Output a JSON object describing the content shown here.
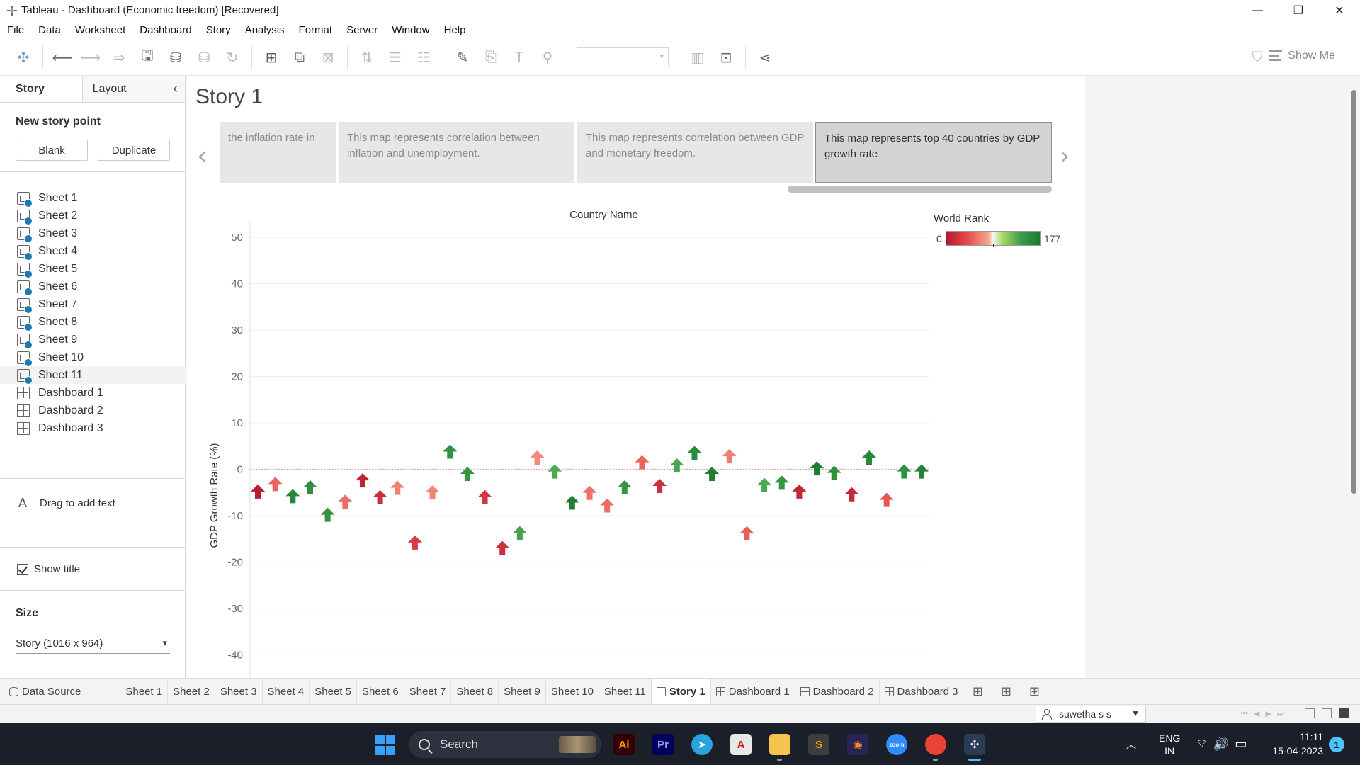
{
  "window": {
    "title": "Tableau - Dashboard (Economic freedom) [Recovered]",
    "controls": {
      "minimize": "—",
      "restore": "❐",
      "close": "✕"
    }
  },
  "menu": [
    "File",
    "Data",
    "Worksheet",
    "Dashboard",
    "Story",
    "Analysis",
    "Format",
    "Server",
    "Window",
    "Help"
  ],
  "toolbar": {
    "show_me": "Show Me"
  },
  "left_pane": {
    "tabs": {
      "story": "Story",
      "layout": "Layout",
      "collapse": "‹"
    },
    "new_story_point": "New story point",
    "blank_button": "Blank",
    "duplicate_button": "Duplicate",
    "sheets": [
      "Sheet 1",
      "Sheet 2",
      "Sheet 3",
      "Sheet 4",
      "Sheet 5",
      "Sheet 6",
      "Sheet 7",
      "Sheet 8",
      "Sheet 9",
      "Sheet 10",
      "Sheet 11"
    ],
    "dashboards": [
      "Dashboard 1",
      "Dashboard 2",
      "Dashboard 3"
    ],
    "drag_text": "Drag to add text",
    "drag_icon": "A",
    "show_title": "Show title",
    "size_title": "Size",
    "size_value": "Story (1016 x 964)"
  },
  "story": {
    "title": "Story 1",
    "prev_arrow": "‹",
    "next_arrow": "›",
    "points": [
      "the inflation rate in",
      "This  map represents correlation between inflation and unemployment.",
      "This map represents correlation between GDP and  monetary freedom.",
      "This map represents top 40 countries by GDP growth rate"
    ]
  },
  "legend": {
    "title": "World Rank",
    "min": "0",
    "max": "177"
  },
  "chart_data": {
    "type": "scatter",
    "title": "Country Name",
    "xlabel": "",
    "ylabel": "GDP Growth Rate (%)",
    "ylim": [
      -45,
      52
    ],
    "yticks": [
      50,
      40,
      30,
      20,
      10,
      0,
      -10,
      -20,
      -30,
      -40
    ],
    "marker": "arrow",
    "color_scale": {
      "field": "World Rank",
      "min": 0,
      "max": 177,
      "low": "#b2182b",
      "mid": "#f7f7f7",
      "high": "#1a7a34"
    },
    "points": [
      {
        "y": -4.8,
        "rank": 5
      },
      {
        "y": -3.2,
        "rank": 55
      },
      {
        "y": -5.8,
        "rank": 160
      },
      {
        "y": -3.9,
        "rank": 150
      },
      {
        "y": -9.8,
        "rank": 145
      },
      {
        "y": -7.0,
        "rank": 60
      },
      {
        "y": -2.4,
        "rank": 10
      },
      {
        "y": -6.0,
        "rank": 18
      },
      {
        "y": -4.0,
        "rank": 70
      },
      {
        "y": -15.8,
        "rank": 30
      },
      {
        "y": -5.0,
        "rank": 72
      },
      {
        "y": 3.8,
        "rank": 145
      },
      {
        "y": -1.0,
        "rank": 140
      },
      {
        "y": -6.0,
        "rank": 25
      },
      {
        "y": -17.0,
        "rank": 20
      },
      {
        "y": -13.8,
        "rank": 125
      },
      {
        "y": 2.5,
        "rank": 75
      },
      {
        "y": -0.5,
        "rank": 118
      },
      {
        "y": -7.2,
        "rank": 170
      },
      {
        "y": -5.1,
        "rank": 62
      },
      {
        "y": -7.8,
        "rank": 60
      },
      {
        "y": -3.9,
        "rank": 142
      },
      {
        "y": 1.5,
        "rank": 55
      },
      {
        "y": -3.6,
        "rank": 20
      },
      {
        "y": 0.8,
        "rank": 122
      },
      {
        "y": 3.5,
        "rank": 155
      },
      {
        "y": -1.0,
        "rank": 172
      },
      {
        "y": 2.8,
        "rank": 68
      },
      {
        "y": -13.8,
        "rank": 52
      },
      {
        "y": -3.4,
        "rank": 120
      },
      {
        "y": -2.9,
        "rank": 142
      },
      {
        "y": -4.8,
        "rank": 12
      },
      {
        "y": 0.2,
        "rank": 172
      },
      {
        "y": -0.8,
        "rank": 150
      },
      {
        "y": -5.4,
        "rank": 15
      },
      {
        "y": 2.5,
        "rank": 160
      },
      {
        "y": -6.6,
        "rank": 48
      },
      {
        "y": -0.5,
        "rank": 148
      },
      {
        "y": -0.5,
        "rank": 165
      }
    ]
  },
  "sheet_tabs": [
    {
      "label": "Data Source",
      "icon": "db"
    },
    {
      "label": "Sheet 1"
    },
    {
      "label": "Sheet 2"
    },
    {
      "label": "Sheet 3"
    },
    {
      "label": "Sheet 4"
    },
    {
      "label": "Sheet 5"
    },
    {
      "label": "Sheet 6"
    },
    {
      "label": "Sheet 7"
    },
    {
      "label": "Sheet 8"
    },
    {
      "label": "Sheet 9"
    },
    {
      "label": "Sheet 10"
    },
    {
      "label": "Sheet 11"
    },
    {
      "label": "Story 1",
      "icon": "book",
      "active": true
    },
    {
      "label": "Dashboard 1",
      "icon": "grid"
    },
    {
      "label": "Dashboard 2",
      "icon": "grid"
    },
    {
      "label": "Dashboard 3",
      "icon": "grid"
    }
  ],
  "status": {
    "user": "suwetha s s"
  },
  "taskbar": {
    "search": "Search",
    "lang_top": "ENG",
    "lang_bottom": "IN",
    "time": "11:11",
    "date": "15-04-2023",
    "notifications": "1",
    "apps": [
      {
        "name": "illustrator",
        "label": "Ai",
        "bg": "#330000",
        "fg": "#ff9a00"
      },
      {
        "name": "premiere",
        "label": "Pr",
        "bg": "#00005b",
        "fg": "#9999ff"
      },
      {
        "name": "telegram",
        "label": "➤",
        "bg": "#2aa3dd",
        "fg": "#ffffff"
      },
      {
        "name": "acrobat",
        "label": "A",
        "bg": "#e8e8e8",
        "fg": "#d11b1b"
      },
      {
        "name": "file-explorer",
        "label": "",
        "bg": "#f4c54a",
        "fg": "#ffffff"
      },
      {
        "name": "sublime",
        "label": "S",
        "bg": "#3d3d3d",
        "fg": "#ff9800"
      },
      {
        "name": "eclipse",
        "label": "◉",
        "bg": "#2c2255",
        "fg": "#f7941e"
      },
      {
        "name": "zoom",
        "label": "zoom",
        "bg": "#2d8cff",
        "fg": "#ffffff"
      },
      {
        "name": "chrome",
        "label": "",
        "bg": "#ea4335",
        "fg": "#ffffff"
      },
      {
        "name": "tableau",
        "label": "✣",
        "bg": "#2b3a55",
        "fg": "#ffffff"
      }
    ]
  }
}
